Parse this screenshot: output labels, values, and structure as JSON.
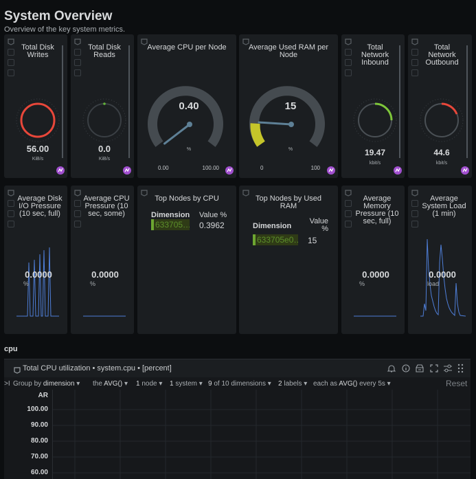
{
  "page": {
    "title": "System Overview",
    "subtitle": "Overview of the key system metrics."
  },
  "cards": {
    "disk_writes": {
      "title": "Total Disk Writes",
      "value": "56.00",
      "unit": "KiB/s"
    },
    "disk_reads": {
      "title": "Total Disk Reads",
      "value": "0.0",
      "unit": "KiB/s"
    },
    "cpu_node": {
      "title": "Average CPU per Node",
      "value": "0.40",
      "unit": "%",
      "min": "0.00",
      "max": "100.00",
      "fraction": 0.004
    },
    "ram_node": {
      "title": "Average Used RAM per Node",
      "value": "15",
      "unit": "%",
      "min": "0",
      "max": "100",
      "fraction": 0.15
    },
    "net_in": {
      "title": "Total Network Inbound",
      "value": "19.47",
      "unit": "kbit/s"
    },
    "net_out": {
      "title": "Total Network Outbound",
      "value": "44.6",
      "unit": "kbit/s"
    },
    "disk_io": {
      "title": "Average Disk I/O Pressure (10 sec, full)",
      "value": "0.0000",
      "unit": "%"
    },
    "cpu_pressure": {
      "title": "Average CPU Pressure (10 sec, some)",
      "value": "0.0000",
      "unit": "%"
    },
    "top_cpu": {
      "title": "Top Nodes by CPU",
      "col_dim": "Dimension",
      "col_val": "Value %",
      "row_dim": "633705…",
      "row_val": "0.3962",
      "row_fraction": 0.11
    },
    "top_ram": {
      "title": "Top Nodes by Used RAM",
      "col_dim": "Dimension",
      "col_val": "Value %",
      "row_dim": "633705e0…",
      "row_val": "15",
      "row_fraction": 0.15
    },
    "mem_pressure": {
      "title": "Average Memory Pressure (10 sec, full)",
      "value": "0.0000",
      "unit": "%"
    },
    "sys_load": {
      "title": "Average System Load (1 min)",
      "value": "0.0000",
      "unit": "load"
    }
  },
  "section": {
    "title": "cpu"
  },
  "chart": {
    "title": "Total CPU utilization • system.cpu • [percent]",
    "ctrl_prefix": ">I",
    "group_by_label": "Group by",
    "group_by_value": "dimension",
    "agg_prefix": "the",
    "agg_value": "AVG()",
    "nodes_count": "1",
    "nodes_label": "node",
    "systems_count": "1",
    "systems_label": "system",
    "dims_count": "9",
    "dims_label": "of 10 dimensions",
    "labels_count": "2",
    "labels_label": "labels",
    "each_label": "each as",
    "each_value": "AVG()",
    "every_label": "every 5s",
    "reset_label": "Reset",
    "legend_ar": "AR",
    "y_ticks": [
      "100.00",
      "90.00",
      "80.00",
      "70.00",
      "60.00"
    ]
  },
  "colors": {
    "disk_writes_ring": "#e8473a",
    "disk_reads_dot": "#63b33a",
    "net_in_arc": "#7ec63a",
    "net_out_arc": "#e8473a",
    "ram_arc": "#c5c52a",
    "spark": "#4f7fd9",
    "purple": "#a14fcf"
  }
}
